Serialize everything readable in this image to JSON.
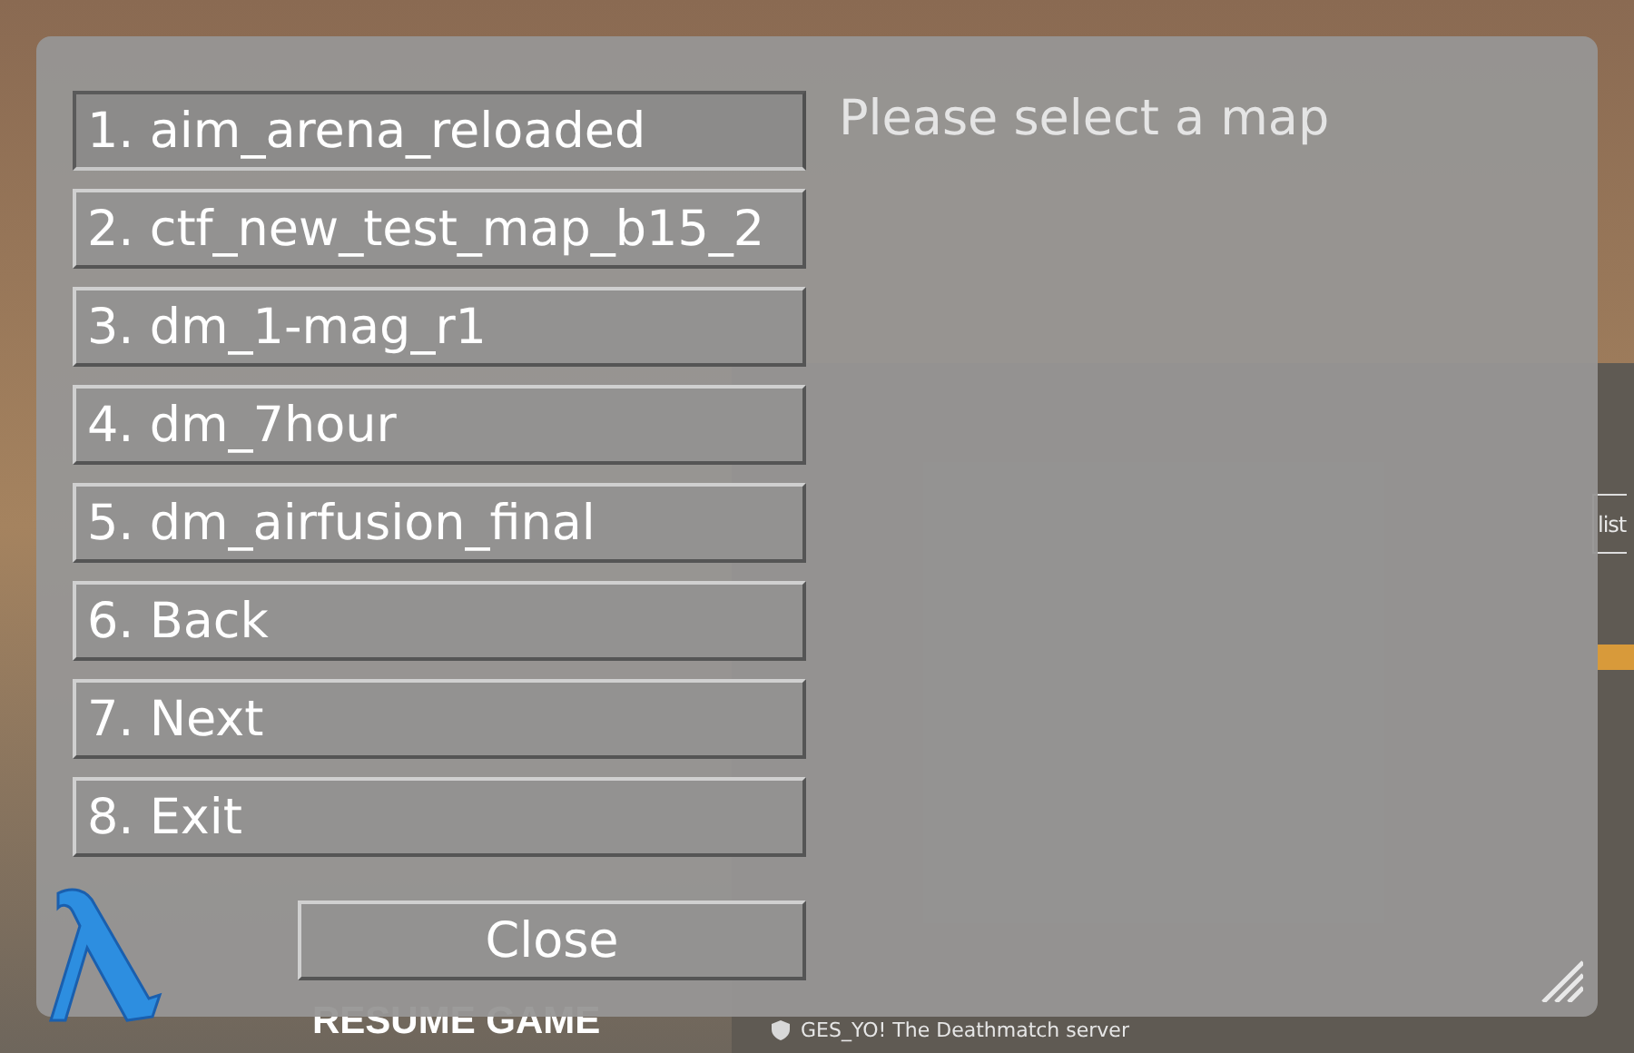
{
  "background": {
    "menu_item": "RESUME GAME",
    "server": "GES_YO! The Deathmatch server",
    "edge_button": "list"
  },
  "dialog": {
    "title": "Please select a map",
    "options": [
      {
        "label": "1. aim_arena_reloaded",
        "selected": true
      },
      {
        "label": "2. ctf_new_test_map_b15_2",
        "selected": false
      },
      {
        "label": "3. dm_1-mag_r1",
        "selected": false
      },
      {
        "label": "4. dm_7hour",
        "selected": false
      },
      {
        "label": "5. dm_airfusion_final",
        "selected": false
      },
      {
        "label": "6. Back",
        "selected": false
      },
      {
        "label": "7. Next",
        "selected": false
      },
      {
        "label": "8. Exit",
        "selected": false
      }
    ],
    "close_button": "Close"
  }
}
